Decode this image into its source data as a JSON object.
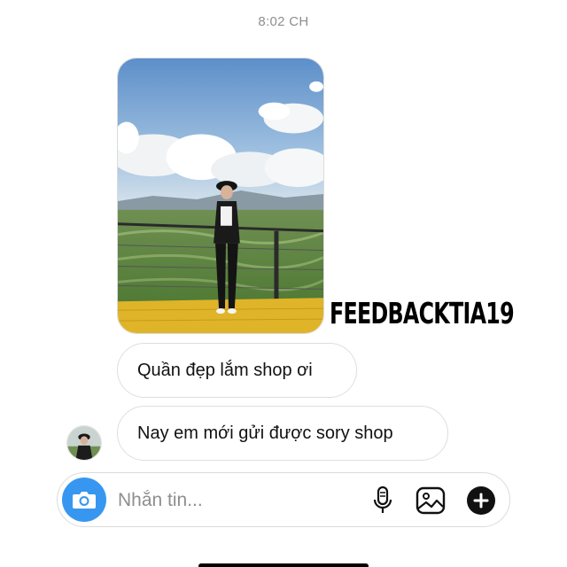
{
  "thread": {
    "timestamp": "8:02 CH",
    "watermark": "FEEDBACKTIA19",
    "messages": [
      {
        "text": "Quần đẹp lắm shop ơi"
      },
      {
        "text": "Nay em mới gửi được sory shop"
      }
    ]
  },
  "composer": {
    "placeholder": "Nhắn tin...",
    "icons": [
      "camera-icon",
      "microphone-icon",
      "gallery-icon",
      "add-icon"
    ]
  },
  "colors": {
    "accent": "#3797f0",
    "bubble_border": "#dedede",
    "timestamp": "#8e8e8e"
  }
}
